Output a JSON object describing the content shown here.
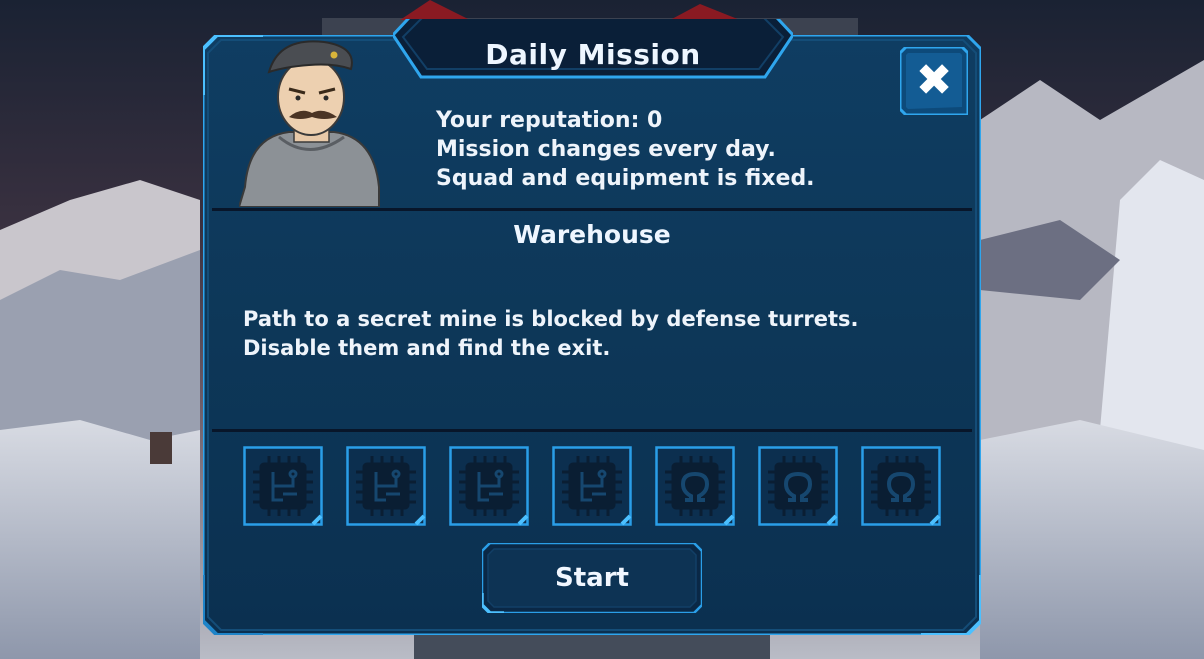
{
  "dialog": {
    "title": "Daily Mission",
    "close_label": "✖",
    "info_lines": [
      "Your reputation: 0",
      "Mission changes every day.",
      "Squad and equipment is fixed."
    ],
    "mission": {
      "name": "Warehouse",
      "description_lines": [
        "Path to a secret mine is blocked by defense turrets.",
        "Disable them and find the exit."
      ]
    },
    "slots": [
      {
        "icon": "chip-circuit-icon"
      },
      {
        "icon": "chip-circuit-icon"
      },
      {
        "icon": "chip-circuit-icon"
      },
      {
        "icon": "chip-circuit-icon"
      },
      {
        "icon": "chip-omega-icon"
      },
      {
        "icon": "chip-omega-icon"
      },
      {
        "icon": "chip-omega-icon"
      }
    ],
    "start_label": "Start"
  },
  "colors": {
    "panel": "#0e3a5e",
    "panel_dark": "#0a2c49",
    "frame_accent": "#2a9ee8",
    "divider": "#08162a",
    "text": "#eef4fb"
  }
}
